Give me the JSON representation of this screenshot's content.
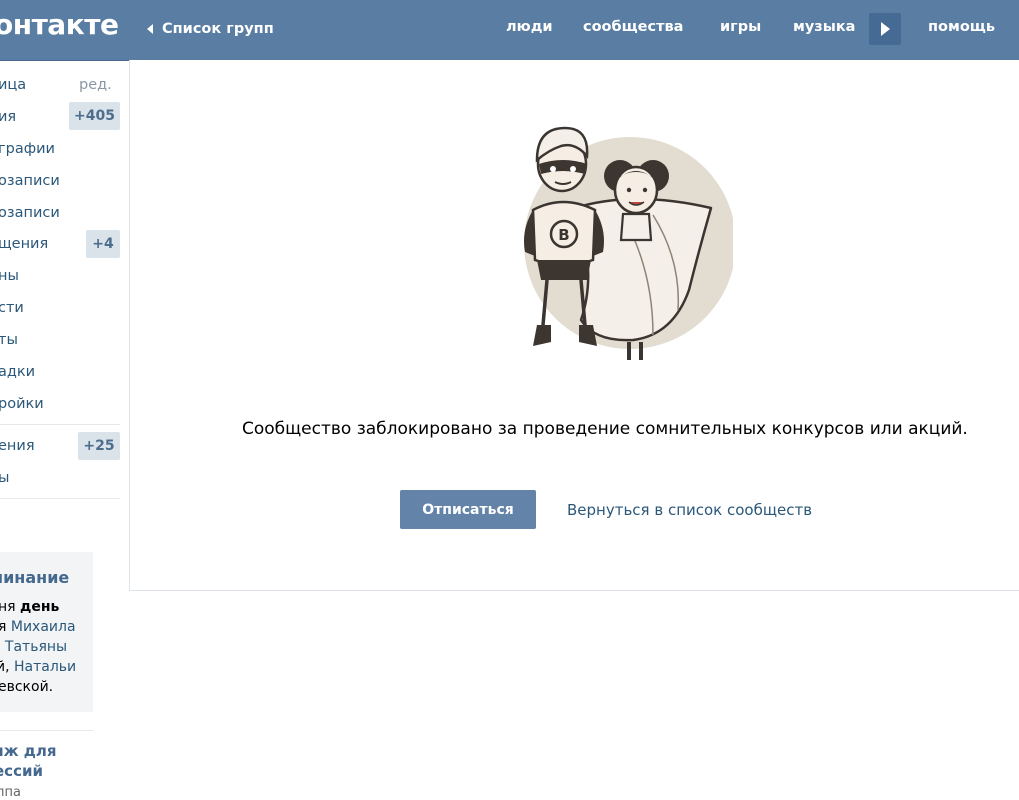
{
  "header": {
    "logo": "онтакте",
    "back_label": "Список групп",
    "nav": [
      "люди",
      "сообщества",
      "игры",
      "музыка"
    ],
    "help": "помощь"
  },
  "sidebar": {
    "edit_label": "ред.",
    "items": [
      {
        "label": "ица"
      },
      {
        "label": "ия",
        "counter": "+405"
      },
      {
        "label": "графии"
      },
      {
        "label": "озаписи"
      },
      {
        "label": "озаписи"
      },
      {
        "label": "щения",
        "counter": "+4"
      },
      {
        "label": "ны"
      },
      {
        "label": "сти"
      },
      {
        "label": "ты"
      },
      {
        "label": "адки"
      },
      {
        "label": "ройки"
      },
      {
        "label": "ения",
        "counter": "+25"
      },
      {
        "label": "ы"
      }
    ]
  },
  "reminder": {
    "title": "минание",
    "line1_plain": "ня ",
    "line1_bold": "день",
    "line2_plain": "я ",
    "line2_name": "Михаила",
    "line3_name": "Татьяны",
    "line4_name": "Натальи",
    "line5": "евской."
  },
  "promo": {
    "title_line1": "яж для",
    "title_line2": "ессий",
    "subtitle": "ппа"
  },
  "main": {
    "blocked_message": "Сообщество заблокировано за проведение сомнительных конкурсов или акций.",
    "unsubscribe_label": "Отписаться",
    "back_link": "Вернуться в список сообществ"
  },
  "colors": {
    "header_bg": "#597da3",
    "button_bg": "#6383a8",
    "link": "#2b587a",
    "counter_bg": "#dae2ea"
  }
}
